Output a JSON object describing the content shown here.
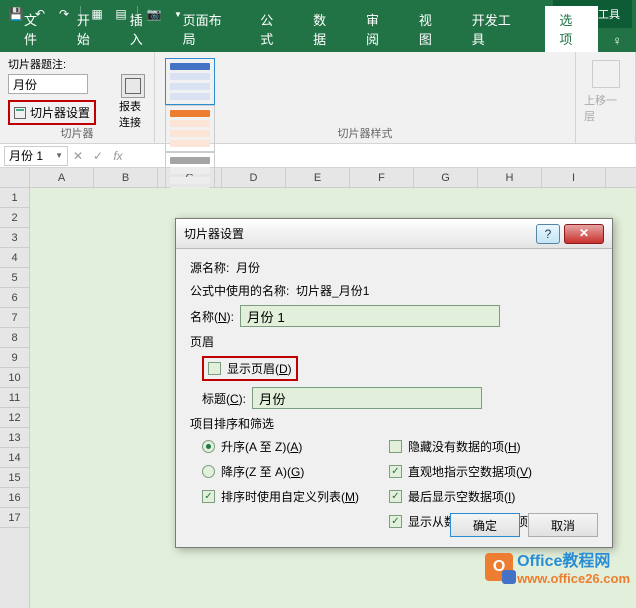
{
  "titlebar": {
    "tool_tab": "切片器工具"
  },
  "tabs": {
    "file": "文件",
    "home": "开始",
    "insert": "插入",
    "layout": "页面布局",
    "formula": "公式",
    "data": "数据",
    "review": "审阅",
    "view": "视图",
    "dev": "开发工具",
    "options": "选项"
  },
  "ribbon": {
    "caption_label": "切片器题注:",
    "caption_value": "月份",
    "report_conn": "报表连接",
    "slicer_settings": "切片器设置",
    "group_slicer": "切片器",
    "group_styles": "切片器样式",
    "bring_forward": "上移一层"
  },
  "formula_bar": {
    "name": "月份 1"
  },
  "columns": [
    "A",
    "B",
    "C",
    "D",
    "E",
    "F",
    "G",
    "H",
    "I"
  ],
  "rows": [
    "1",
    "2",
    "3",
    "4",
    "5",
    "6",
    "7",
    "8",
    "9",
    "10",
    "11",
    "12",
    "13",
    "14",
    "15",
    "16",
    "17"
  ],
  "dialog": {
    "title": "切片器设置",
    "source_label": "源名称:",
    "source_value": "月份",
    "formula_name_label": "公式中使用的名称:",
    "formula_name_value": "切片器_月份1",
    "name_label": "名称(N):",
    "name_value": "月份 1",
    "header_section": "页眉",
    "show_header": "显示页眉(D)",
    "caption_label": "标题(C):",
    "caption_value": "月份",
    "sort_section": "项目排序和筛选",
    "sort_asc": "升序(A 至 Z)(A)",
    "sort_desc": "降序(Z 至 A)(G)",
    "use_custom": "排序时使用自定义列表(M)",
    "hide_nodata": "隐藏没有数据的项(H)",
    "mark_nodata": "直观地指示空数据项(V)",
    "show_last": "最后显示空数据项(I)",
    "show_deleted": "显示从数据源删除的项目(O)",
    "ok": "确定",
    "cancel": "取消"
  },
  "watermark": {
    "line1": "Office教程网",
    "line2": "www.office26.com"
  }
}
